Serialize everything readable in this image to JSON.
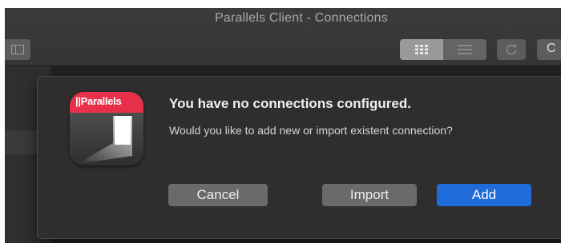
{
  "window": {
    "title": "Parallels Client - Connections"
  },
  "toolbar": {
    "sidebar_toggle_icon": "sidebar-icon",
    "grid_view_icon": "grid-icon",
    "list_view_icon": "list-icon",
    "refresh_icon": "refresh-icon",
    "more_label": "C"
  },
  "dialog": {
    "app_icon": {
      "name": "parallels-app-icon",
      "brand_text": "||Parallels",
      "brand_color": "#e8304a"
    },
    "heading": "You have no connections configured.",
    "message": "Would you like to add new or import existent connection?",
    "buttons": {
      "cancel": "Cancel",
      "import": "Import",
      "add": "Add"
    },
    "accent_color": "#1f6bd9"
  }
}
